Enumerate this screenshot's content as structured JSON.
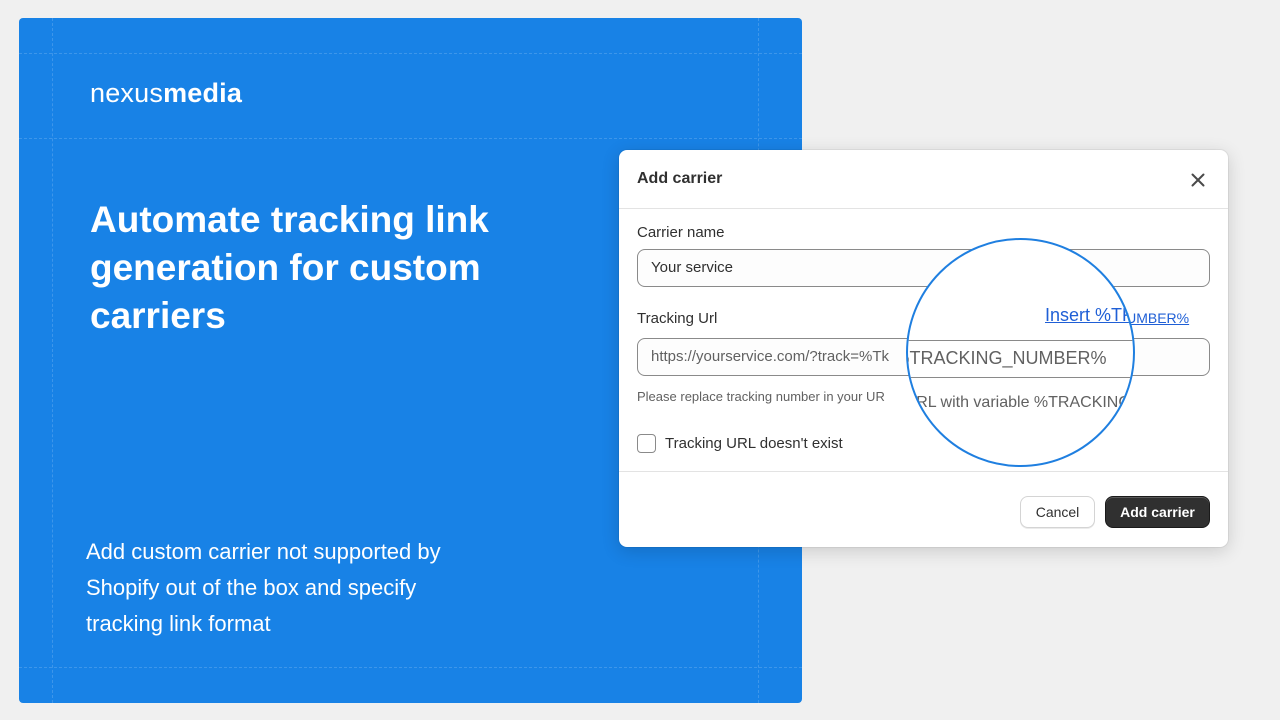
{
  "brand": {
    "name_light": "nexus",
    "name_bold": "media"
  },
  "promo": {
    "headline": "Automate tracking link generation for custom carriers",
    "subtext": "Add custom carrier not supported by Shopify out of the box and specify tracking link format"
  },
  "modal": {
    "title": "Add carrier",
    "carrier_name_label": "Carrier name",
    "carrier_name_value": "Your service",
    "tracking_url_label": "Tracking Url",
    "insert_link_label": "Insert %TRACKING_NUMBER%",
    "insert_link_visible_tail": "NUMBER%",
    "tracking_url_value": "https://yourservice.com/?track=%TRACKING_NUMBER%",
    "tracking_url_visible": "https://yourservice.com/?track=%Tk",
    "help_text": "Please replace tracking number in your URL with variable %TRACKING_NUMBER%",
    "help_text_visible": "Please replace tracking number in your UR",
    "checkbox_label": "Tracking URL doesn't exist",
    "cancel_label": "Cancel",
    "submit_label": "Add carrier"
  },
  "magnifier": {
    "link_text": "Insert %TRACKING_",
    "url_text": "k=%TRACKING_NUMBER%",
    "help_text": "ur URL with variable %TRACKING_NUMBER%"
  },
  "colors": {
    "background": "#f0f0f0",
    "promo_blue": "#1882e6",
    "link_blue": "#1f5fd6",
    "primary_button": "#303030"
  }
}
